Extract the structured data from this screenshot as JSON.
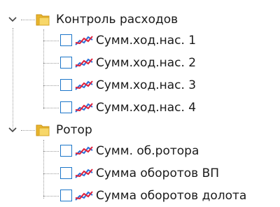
{
  "tree": {
    "groups": [
      {
        "label": "Контроль расходов",
        "icon": "folder-icon",
        "expanded": true,
        "items": [
          {
            "label": "Сумм.ход.нас. 1",
            "icon": "line-series-icon",
            "checked": false
          },
          {
            "label": "Сумм.ход.нас. 2",
            "icon": "line-series-icon",
            "checked": false
          },
          {
            "label": "Сумм.ход.нас. 3",
            "icon": "line-series-icon",
            "checked": false
          },
          {
            "label": "Сумм.ход.нас. 4",
            "icon": "line-series-icon",
            "checked": false
          }
        ]
      },
      {
        "label": "Ротор",
        "icon": "folder-icon",
        "expanded": true,
        "items": [
          {
            "label": "Сумм. об.ротора",
            "icon": "line-series-icon",
            "checked": false
          },
          {
            "label": "Сумма оборотов ВП",
            "icon": "line-series-icon",
            "checked": false
          },
          {
            "label": "Сумма оборотов долота",
            "icon": "line-series-icon",
            "checked": false
          }
        ]
      }
    ]
  },
  "colors": {
    "checkbox_border": "#1c76c9",
    "folder_yellow": "#f3c94b",
    "series_red": "#e0203a",
    "series_blue": "#2a6fd8",
    "connector": "#9a9a9a"
  }
}
